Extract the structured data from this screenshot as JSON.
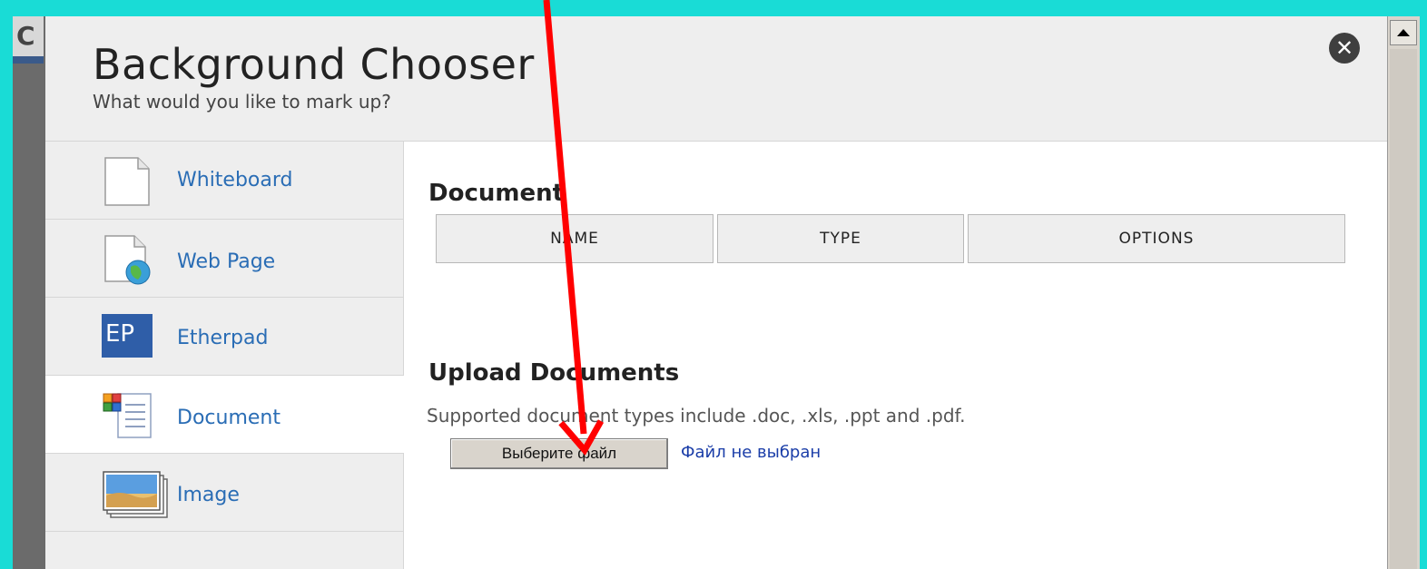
{
  "page": {
    "partial_letter": "C"
  },
  "dialog": {
    "title": "Background Chooser",
    "subtitle": "What would you like to mark up?",
    "close_icon": "close-icon"
  },
  "sidebar": {
    "items": [
      {
        "label": "Whiteboard",
        "icon": "whiteboard-icon",
        "active": false
      },
      {
        "label": "Web Page",
        "icon": "web-page-icon",
        "active": false
      },
      {
        "label": "Etherpad",
        "icon": "etherpad-icon",
        "icon_text": "EP",
        "active": false
      },
      {
        "label": "Document",
        "icon": "document-icon",
        "active": true
      },
      {
        "label": "Image",
        "icon": "image-icon",
        "active": false
      }
    ]
  },
  "main": {
    "document_heading": "Document",
    "table": {
      "columns": [
        "NAME",
        "TYPE",
        "OPTIONS"
      ]
    },
    "upload_heading": "Upload Documents",
    "supported_text": "Supported document types include .doc, .xls, .ppt and .pdf.",
    "file_button_label": "Выберите файл",
    "file_status": "Файл не выбран"
  },
  "colors": {
    "background": "#19dcd6",
    "link_blue": "#2a6db5",
    "annotation_arrow": "#ff0000"
  }
}
